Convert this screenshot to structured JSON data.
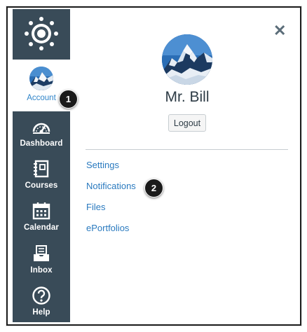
{
  "nav": {
    "logo_icon": "canvas-logo-icon",
    "account_label": "Account",
    "items": [
      {
        "label": "Dashboard",
        "icon": "dashboard-icon"
      },
      {
        "label": "Courses",
        "icon": "courses-icon"
      },
      {
        "label": "Calendar",
        "icon": "calendar-icon"
      },
      {
        "label": "Inbox",
        "icon": "inbox-icon"
      },
      {
        "label": "Help",
        "icon": "help-icon"
      }
    ]
  },
  "tray": {
    "close_icon": "close-icon",
    "user_name": "Mr. Bill",
    "logout_label": "Logout",
    "links": [
      "Settings",
      "Notifications",
      "Files",
      "ePortfolios"
    ]
  },
  "callouts": [
    "1",
    "2"
  ],
  "colors": {
    "nav_bg": "#394b58",
    "link_blue": "#2a7abf",
    "account_blue": "#2f84c9",
    "badge_bg": "#1b1b1b"
  }
}
